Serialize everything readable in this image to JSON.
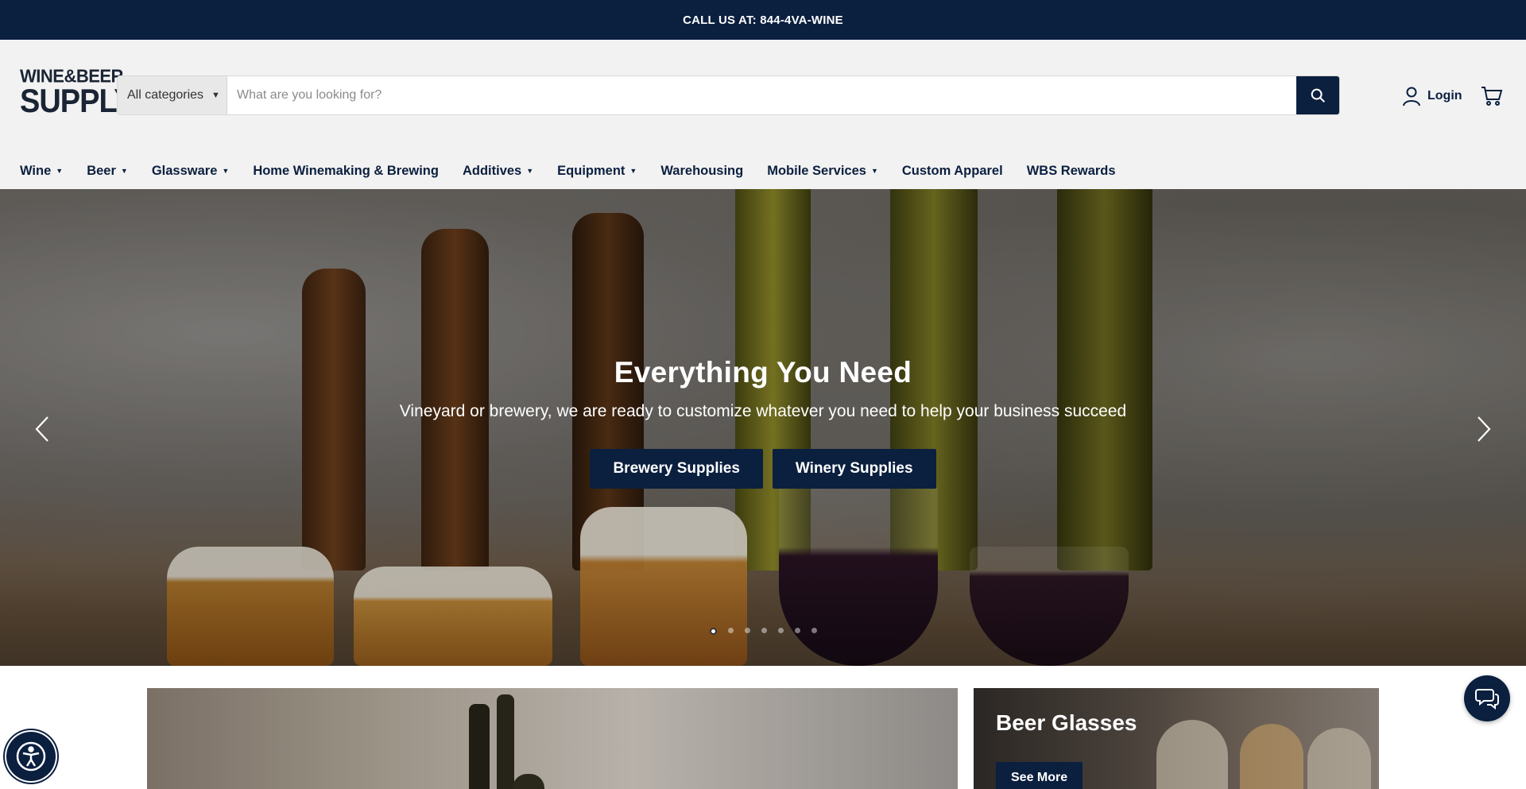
{
  "topbar": {
    "text": "CALL US AT: 844-4VA-WINE"
  },
  "logo": {
    "line1": "WINE&BEER",
    "line2": "SUPPLY"
  },
  "search": {
    "category_label": "All categories",
    "placeholder": "What are you looking for?"
  },
  "account": {
    "login_label": "Login"
  },
  "nav": {
    "items": [
      {
        "label": "Wine",
        "dropdown": true
      },
      {
        "label": "Beer",
        "dropdown": true
      },
      {
        "label": "Glassware",
        "dropdown": true
      },
      {
        "label": "Home Winemaking & Brewing",
        "dropdown": false
      },
      {
        "label": "Additives",
        "dropdown": true
      },
      {
        "label": "Equipment",
        "dropdown": true
      },
      {
        "label": "Warehousing",
        "dropdown": false
      },
      {
        "label": "Mobile Services",
        "dropdown": true
      },
      {
        "label": "Custom Apparel",
        "dropdown": false
      },
      {
        "label": "WBS Rewards",
        "dropdown": false
      }
    ]
  },
  "hero": {
    "title": "Everything You Need",
    "subtitle": "Vineyard or brewery, we are ready to customize whatever you need to help your business succeed",
    "buttons": [
      "Brewery Supplies",
      "Winery Supplies"
    ],
    "slides_total": 7,
    "active_slide": 1
  },
  "promo": {
    "right_title": "Beer Glasses",
    "right_button": "See More"
  },
  "colors": {
    "brand": "#0b1f3f",
    "header_bg": "#f2f2f2"
  },
  "icons": [
    "search-icon",
    "user-icon",
    "cart-icon",
    "chevron-left-icon",
    "chevron-right-icon",
    "chat-icon",
    "accessibility-icon"
  ]
}
